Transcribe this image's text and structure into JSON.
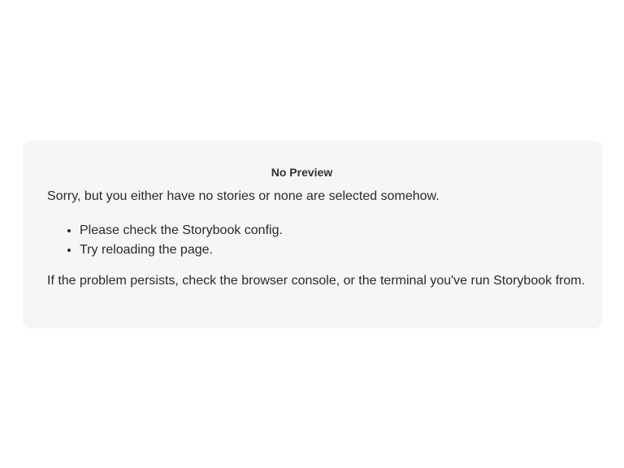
{
  "no_preview": {
    "title": "No Preview",
    "intro": "Sorry, but you either have no stories or none are selected somehow.",
    "tips": [
      "Please check the Storybook config.",
      "Try reloading the page."
    ],
    "outro": "If the problem persists, check the browser console, or the terminal you've run Storybook from."
  }
}
